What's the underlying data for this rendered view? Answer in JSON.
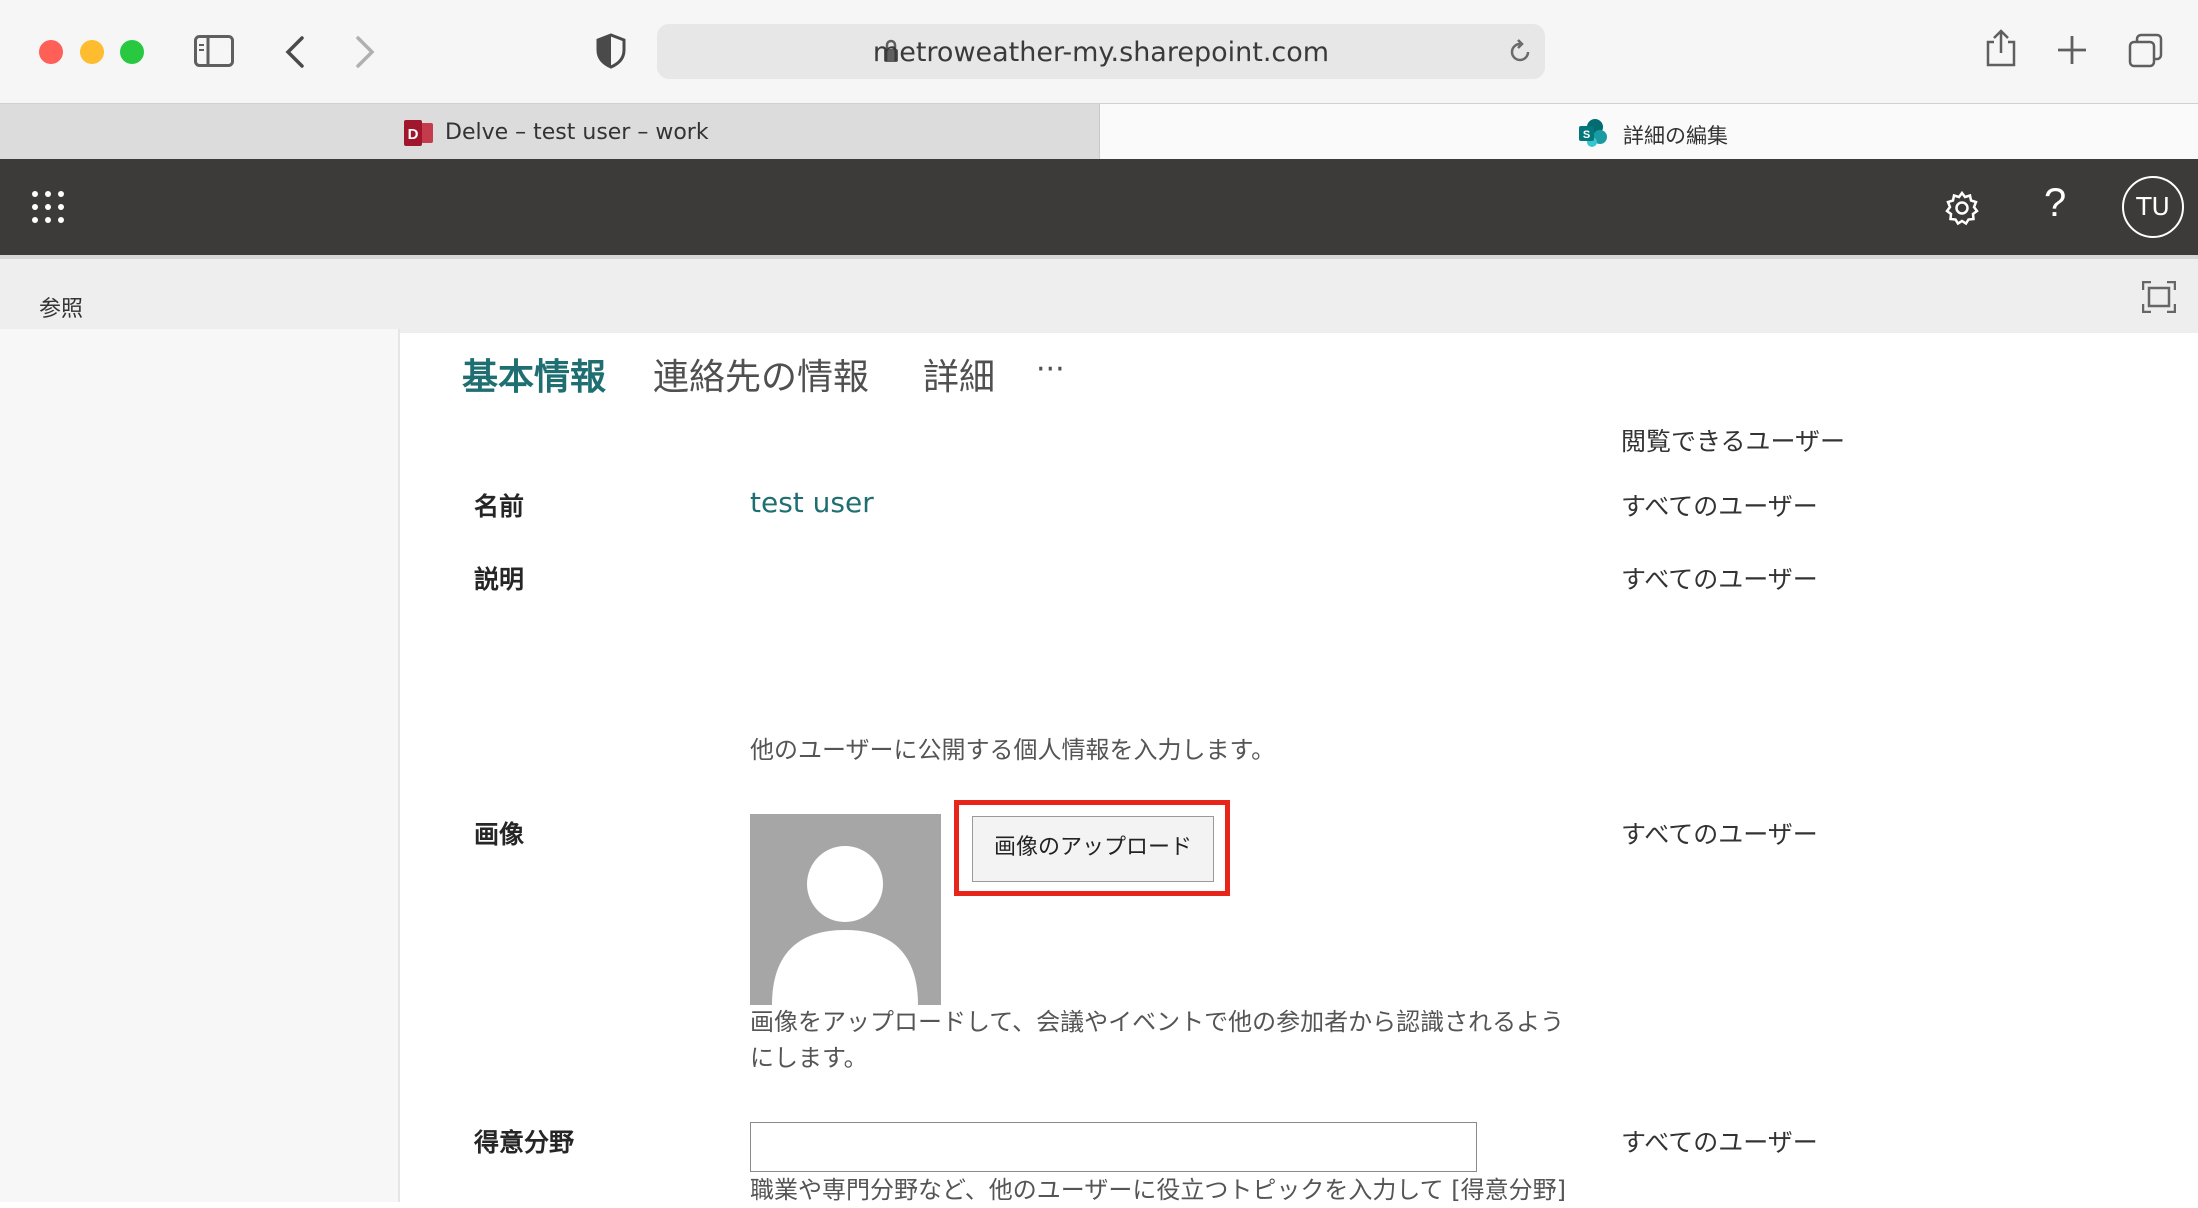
{
  "browser": {
    "url": "metroweather-my.sharepoint.com",
    "tabs": [
      {
        "label": "Delve – test user – work",
        "icon": "delve-icon"
      },
      {
        "label": "詳細の編集",
        "icon": "sharepoint-icon"
      }
    ]
  },
  "header": {
    "avatar_initials": "TU"
  },
  "ribbon": {
    "browse_label": "参照"
  },
  "content_tabs": [
    {
      "label": "基本情報",
      "active": true
    },
    {
      "label": "連絡先の情報"
    },
    {
      "label": "詳細"
    },
    {
      "label": "···"
    }
  ],
  "visibility_header": "閲覧できるユーザー",
  "fields": {
    "name": {
      "label": "名前",
      "value": "test user",
      "visibility": "すべてのユーザー"
    },
    "description": {
      "label": "説明",
      "visibility": "すべてのユーザー",
      "help": "他のユーザーに公開する個人情報を入力します。"
    },
    "picture": {
      "label": "画像",
      "button": "画像のアップロード",
      "visibility": "すべてのユーザー",
      "help_line1": "画像をアップロードして、会議やイベントで他の参加者から認識されるよう",
      "help_line2": "にします。"
    },
    "expertise": {
      "label": "得意分野",
      "value": "",
      "visibility": "すべてのユーザー",
      "help": "職業や専門分野など、他のユーザーに役立つトピックを入力して [得意分野]"
    }
  },
  "colors": {
    "accent": "#1f6f72",
    "header_bg": "#3c3b39",
    "highlight": "#e8251a"
  }
}
